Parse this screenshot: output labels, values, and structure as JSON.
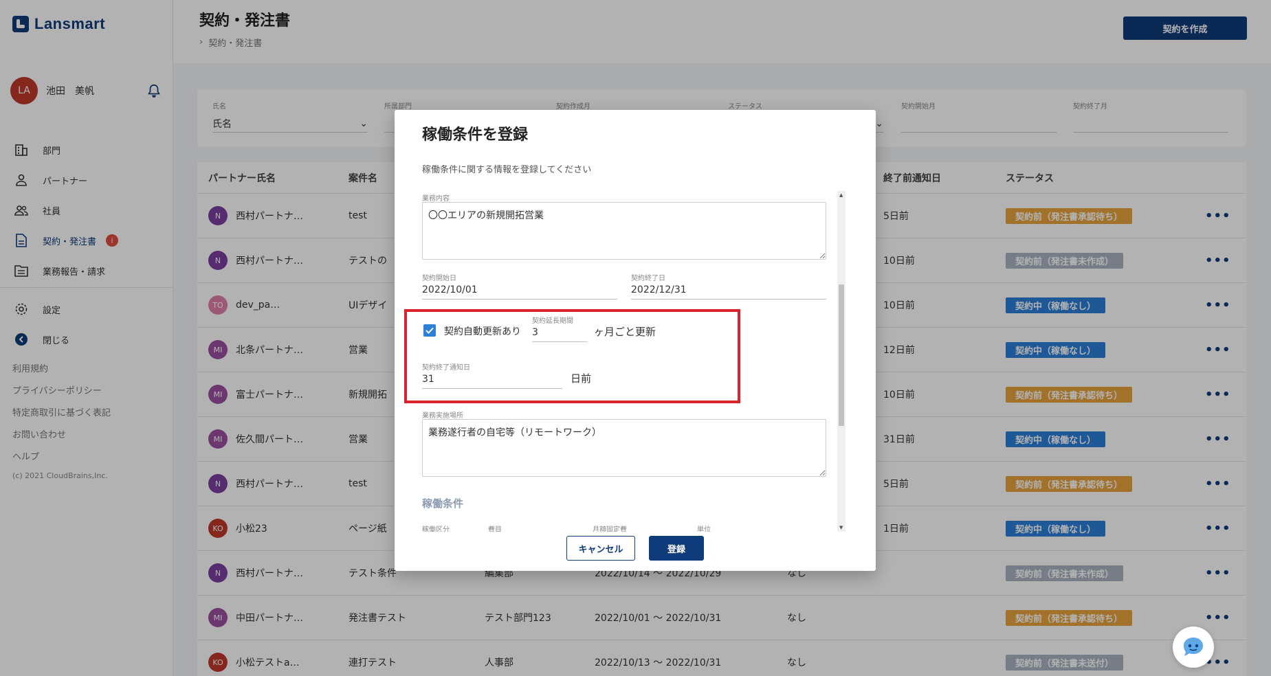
{
  "app": {
    "name": "Lansmart"
  },
  "user": {
    "initials": "LA",
    "name": "池田　美帆"
  },
  "nav": {
    "items": [
      {
        "label": "部門"
      },
      {
        "label": "パートナー"
      },
      {
        "label": "社員"
      },
      {
        "label": "契約・発注書",
        "badge": "i"
      },
      {
        "label": "業務報告・請求"
      }
    ],
    "settings": "設定",
    "close": "閉じる"
  },
  "links": [
    "利用規約",
    "プライバシーポリシー",
    "特定商取引に基づく表記",
    "お問い合わせ",
    "ヘルプ"
  ],
  "copyright": "(c) 2021 CloudBrains,Inc.",
  "header": {
    "title": "契約・発注書",
    "breadcrumb": "契約・発注書",
    "create_button": "契約を作成"
  },
  "filters": [
    {
      "label": "氏名",
      "value": "氏名"
    },
    {
      "label": "所属部門",
      "value": ""
    },
    {
      "label": "契約作成月",
      "value": ""
    },
    {
      "label": "ステータス",
      "value": ""
    },
    {
      "label": "契約開始月",
      "value": ""
    },
    {
      "label": "契約終了月",
      "value": ""
    }
  ],
  "table": {
    "headers": [
      "パートナー氏名",
      "案件名",
      "",
      "",
      "",
      "終了前通知日",
      "ステータス"
    ],
    "rows": [
      {
        "initials": "N",
        "color": "#7b3f9e",
        "name": "西村パートナ…",
        "case": "test",
        "dept": "",
        "period": "",
        "renew": "",
        "notice": "5日前",
        "status": "契約前（発注書承認待ち）",
        "status_color": "#e8a33d"
      },
      {
        "initials": "N",
        "color": "#7b3f9e",
        "name": "西村パートナ…",
        "case": "テストの",
        "dept": "",
        "period": "",
        "renew": "",
        "notice": "10日前",
        "status": "契約前（発注書未作成）",
        "status_color": "#aab4c0"
      },
      {
        "initials": "TO",
        "color": "#e07fa8",
        "name": "dev_pa…",
        "case": "UIデザイ",
        "dept": "",
        "period": "",
        "renew": "",
        "notice": "10日前",
        "status": "契約中（稼働なし）",
        "status_color": "#2d7fd8"
      },
      {
        "initials": "MI",
        "color": "#9b4f9e",
        "name": "北条パートナ…",
        "case": "営業",
        "dept": "",
        "period": "",
        "renew": "",
        "notice": "12日前",
        "status": "契約中（稼働なし）",
        "status_color": "#2d7fd8"
      },
      {
        "initials": "MI",
        "color": "#9b4f9e",
        "name": "富士パートナ…",
        "case": "新規開拓",
        "dept": "",
        "period": "",
        "renew": "",
        "notice": "10日前",
        "status": "契約前（発注書承認待ち）",
        "status_color": "#e8a33d"
      },
      {
        "initials": "MI",
        "color": "#9b4f9e",
        "name": "佐久間パート…",
        "case": "営業",
        "dept": "",
        "period": "",
        "renew": "",
        "notice": "31日前",
        "status": "契約中（稼働なし）",
        "status_color": "#2d7fd8"
      },
      {
        "initials": "N",
        "color": "#7b3f9e",
        "name": "西村パートナ…",
        "case": "test",
        "dept": "",
        "period": "",
        "renew": "",
        "notice": "5日前",
        "status": "契約前（発注書承認待ち）",
        "status_color": "#e8a33d"
      },
      {
        "initials": "KO",
        "color": "#c0392b",
        "name": "小松23",
        "case": "ページ紙",
        "dept": "",
        "period": "",
        "renew": "",
        "notice": "1日前",
        "status": "契約中（稼働なし）",
        "status_color": "#2d7fd8"
      },
      {
        "initials": "N",
        "color": "#7b3f9e",
        "name": "西村パートナ…",
        "case": "テスト条件",
        "dept": "編集部",
        "period": "2022/10/14 ～ 2022/10/29",
        "renew": "なし",
        "notice": "",
        "status": "契約前（発注書未作成）",
        "status_color": "#aab4c0"
      },
      {
        "initials": "MI",
        "color": "#9b4f9e",
        "name": "中田パートナ…",
        "case": "発注書テスト",
        "dept": "テスト部門123",
        "period": "2022/10/01 ～ 2022/10/31",
        "renew": "なし",
        "notice": "",
        "status": "契約前（発注書承認待ち）",
        "status_color": "#e8a33d"
      },
      {
        "initials": "KO",
        "color": "#c0392b",
        "name": "小松テストa…",
        "case": "連打テスト",
        "dept": "人事部",
        "period": "2022/10/13 ～ 2022/10/31",
        "renew": "なし",
        "notice": "",
        "status": "契約前（発注書未送付）",
        "status_color": "#aab4c0"
      }
    ]
  },
  "modal": {
    "title": "稼働条件を登録",
    "description": "稼働条件に関する情報を登録してください",
    "work_content_label": "業務内容",
    "work_content_value": "〇〇エリアの新規開拓営業",
    "start_label": "契約開始日",
    "start_value": "2022/10/01",
    "end_label": "契約終了日",
    "end_value": "2022/12/31",
    "auto_renew_label": "契約自動更新あり",
    "extension_label": "契約延長期間",
    "extension_value": "3",
    "extension_suffix": "ヶ月ごと更新",
    "notice_label": "契約終了通知日",
    "notice_value": "31",
    "notice_suffix": "日前",
    "place_label": "業務実施場所",
    "place_value": "業務遂行者の自宅等（リモートワーク）",
    "conditions_heading": "稼働条件",
    "cond_col1": "稼働区分",
    "cond_col2": "費目",
    "cond_col3": "月額固定費",
    "cond_col4": "単位",
    "cancel": "キャンセル",
    "submit": "登録"
  }
}
